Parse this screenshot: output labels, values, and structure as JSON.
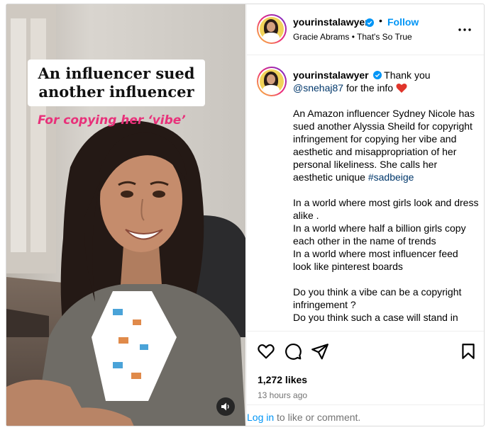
{
  "post": {
    "media": {
      "overlay_title": "An influencer sued\nanother influencer",
      "overlay_subtitle": "For copying her ‘vibe’",
      "sound_icon": "speaker-icon"
    },
    "header": {
      "username": "yourinstalawyer",
      "separator": "•",
      "follow_label": "Follow",
      "audio_line": "Gracie Abrams • That's So True",
      "more_icon": "more-horizontal-icon"
    },
    "caption": {
      "username": "yourinstalawyer",
      "greeting": "Thank you",
      "mention": "@snehaj87",
      "for_the_info": "for the info",
      "heart_color": "#e0352b",
      "paragraph_1_text": "An Amazon influencer Sydney Nicole has sued another Alyssia Sheild for copyright infringement for copying her vibe and aesthetic and misappropriation of her personal likeliness. She calls her aesthetic unique",
      "hashtag": "#sadbeige",
      "paragraph_2": "In a world where most girls look and dress alike .\nIn a world where half a billion girls copy each other in the name of trends\nIn a world where most influencer feed look like pinterest boards",
      "paragraph_3": "Do you think a vibe can be a copyright infringement ?\nDo you think such a case will stand in"
    },
    "actions": {
      "icons": [
        "heart-outline-icon",
        "comment-icon",
        "share-icon",
        "bookmark-icon"
      ],
      "likes": "1,272 likes",
      "timestamp": "13 hours ago",
      "login_link": "Log in",
      "login_rest": " to like or comment."
    },
    "colors": {
      "accent": "#0095f6",
      "link": "#00376b",
      "secondary_text": "#737373",
      "overlay_pink": "#e8317a"
    }
  }
}
